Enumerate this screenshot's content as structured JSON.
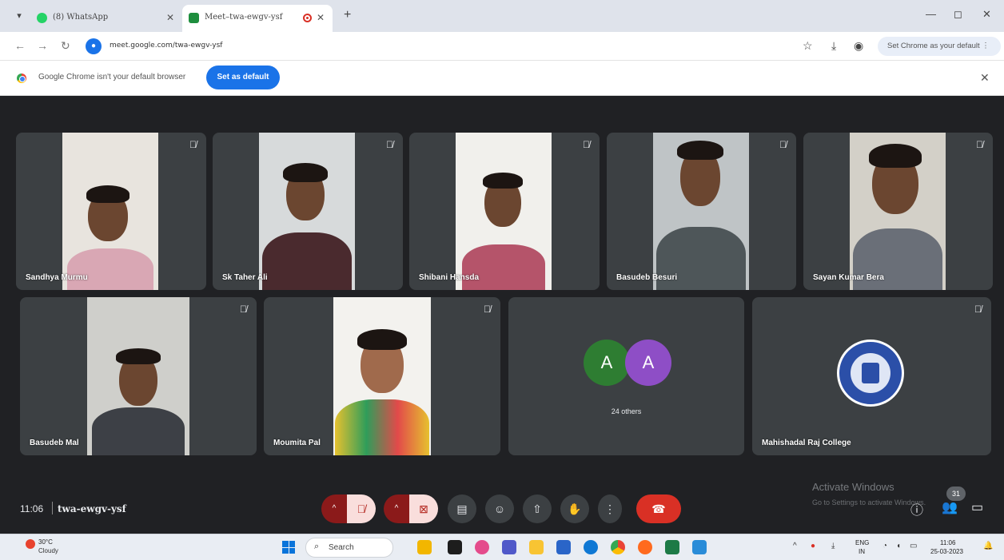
{
  "browser": {
    "tabs": [
      {
        "title": "(8) WhatsApp",
        "active": false,
        "favicon_color": "#25d366"
      },
      {
        "title": "Meet–twa-ewgv-ysf",
        "active": true,
        "favicon_color": "#1e8e3e"
      }
    ],
    "url": "meet.google.com/twa-ewgv-ysf",
    "default_pill": "Set Chrome as your default",
    "infobar": {
      "message": "Google Chrome isn't your default browser",
      "button": "Set as default"
    }
  },
  "meet": {
    "participants": [
      {
        "name": "Sandhya Murmu",
        "muted": true
      },
      {
        "name": "Sk Taher Ali",
        "muted": true
      },
      {
        "name": "Shibani Hansda",
        "muted": true
      },
      {
        "name": "Basudeb Besuri",
        "muted": true
      },
      {
        "name": "Sayan Kumar Bera",
        "muted": true
      },
      {
        "name": "Basudeb Mal",
        "muted": true
      },
      {
        "name": "Moumita Pal",
        "muted": true
      },
      {
        "name": "Mahishadal Raj College",
        "muted": true
      }
    ],
    "others": {
      "avatars": [
        {
          "letter": "A",
          "color": "#2e7d32"
        },
        {
          "letter": "A",
          "color": "#8e4ec6"
        }
      ],
      "label": "24 others"
    },
    "clock": "11:06",
    "meeting_code": "twa-ewgv-ysf",
    "participant_count": "31",
    "watermark_title": "Activate Windows",
    "watermark_sub": "Go to Settings to activate Windows."
  },
  "taskbar": {
    "weather_temp": "30°C",
    "weather_cond": "Cloudy",
    "search_label": "Search",
    "lang_top": "ENG",
    "lang_bottom": "IN",
    "time": "11:06",
    "date": "25-03-2023"
  },
  "colors": {
    "meet_bg": "#202124",
    "tile_bg": "#3c4043",
    "accent_blue": "#1a73e8",
    "end_call_red": "#d93025",
    "muted_btn_red": "#8b1a1a"
  }
}
